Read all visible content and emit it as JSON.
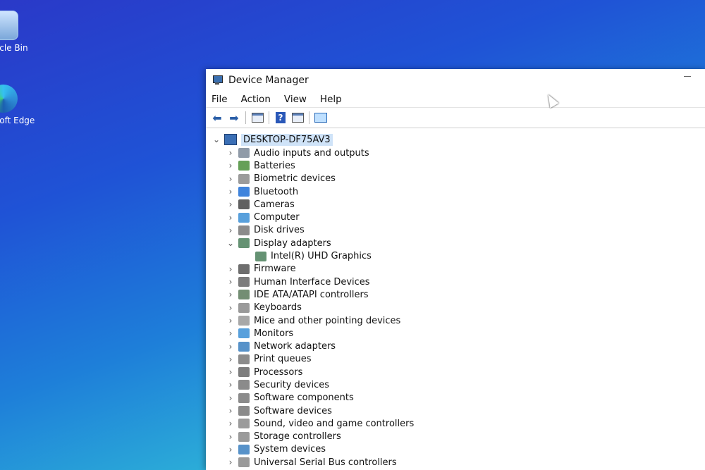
{
  "desktop": {
    "icons": [
      {
        "label": "Recycle Bin"
      },
      {
        "label": "Microsoft Edge"
      }
    ]
  },
  "window": {
    "title": "Device Manager",
    "menu": [
      "File",
      "Action",
      "View",
      "Help"
    ],
    "toolbar": [
      "back-icon",
      "forward-icon",
      "properties-icon",
      "help-icon",
      "update-driver-icon",
      "scan-hardware-icon"
    ]
  },
  "tree": {
    "root": "DESKTOP-DF75AV3",
    "items": [
      {
        "label": "Audio inputs and outputs",
        "icon": "speaker-icon",
        "expanded": false
      },
      {
        "label": "Batteries",
        "icon": "battery-icon",
        "expanded": false
      },
      {
        "label": "Biometric devices",
        "icon": "fingerprint-icon",
        "expanded": false
      },
      {
        "label": "Bluetooth",
        "icon": "bluetooth-icon",
        "expanded": false
      },
      {
        "label": "Cameras",
        "icon": "camera-icon",
        "expanded": false
      },
      {
        "label": "Computer",
        "icon": "computer-icon",
        "expanded": false
      },
      {
        "label": "Disk drives",
        "icon": "disk-icon",
        "expanded": false
      },
      {
        "label": "Display adapters",
        "icon": "display-adapter-icon",
        "expanded": true,
        "children": [
          {
            "label": "Intel(R) UHD Graphics",
            "icon": "display-adapter-icon"
          }
        ]
      },
      {
        "label": "Firmware",
        "icon": "firmware-icon",
        "expanded": false
      },
      {
        "label": "Human Interface Devices",
        "icon": "hid-icon",
        "expanded": false
      },
      {
        "label": "IDE ATA/ATAPI controllers",
        "icon": "ide-controller-icon",
        "expanded": false
      },
      {
        "label": "Keyboards",
        "icon": "keyboard-icon",
        "expanded": false
      },
      {
        "label": "Mice and other pointing devices",
        "icon": "mouse-icon",
        "expanded": false
      },
      {
        "label": "Monitors",
        "icon": "monitor-icon",
        "expanded": false
      },
      {
        "label": "Network adapters",
        "icon": "network-icon",
        "expanded": false
      },
      {
        "label": "Print queues",
        "icon": "printer-icon",
        "expanded": false
      },
      {
        "label": "Processors",
        "icon": "processor-icon",
        "expanded": false
      },
      {
        "label": "Security devices",
        "icon": "security-icon",
        "expanded": false
      },
      {
        "label": "Software components",
        "icon": "software-component-icon",
        "expanded": false
      },
      {
        "label": "Software devices",
        "icon": "software-device-icon",
        "expanded": false
      },
      {
        "label": "Sound, video and game controllers",
        "icon": "sound-icon",
        "expanded": false
      },
      {
        "label": "Storage controllers",
        "icon": "storage-icon",
        "expanded": false
      },
      {
        "label": "System devices",
        "icon": "system-icon",
        "expanded": false
      },
      {
        "label": "Universal Serial Bus controllers",
        "icon": "usb-icon",
        "expanded": false
      }
    ]
  },
  "colors": {
    "selection": "#cfe3f8",
    "accent": "#2b5fa8"
  }
}
